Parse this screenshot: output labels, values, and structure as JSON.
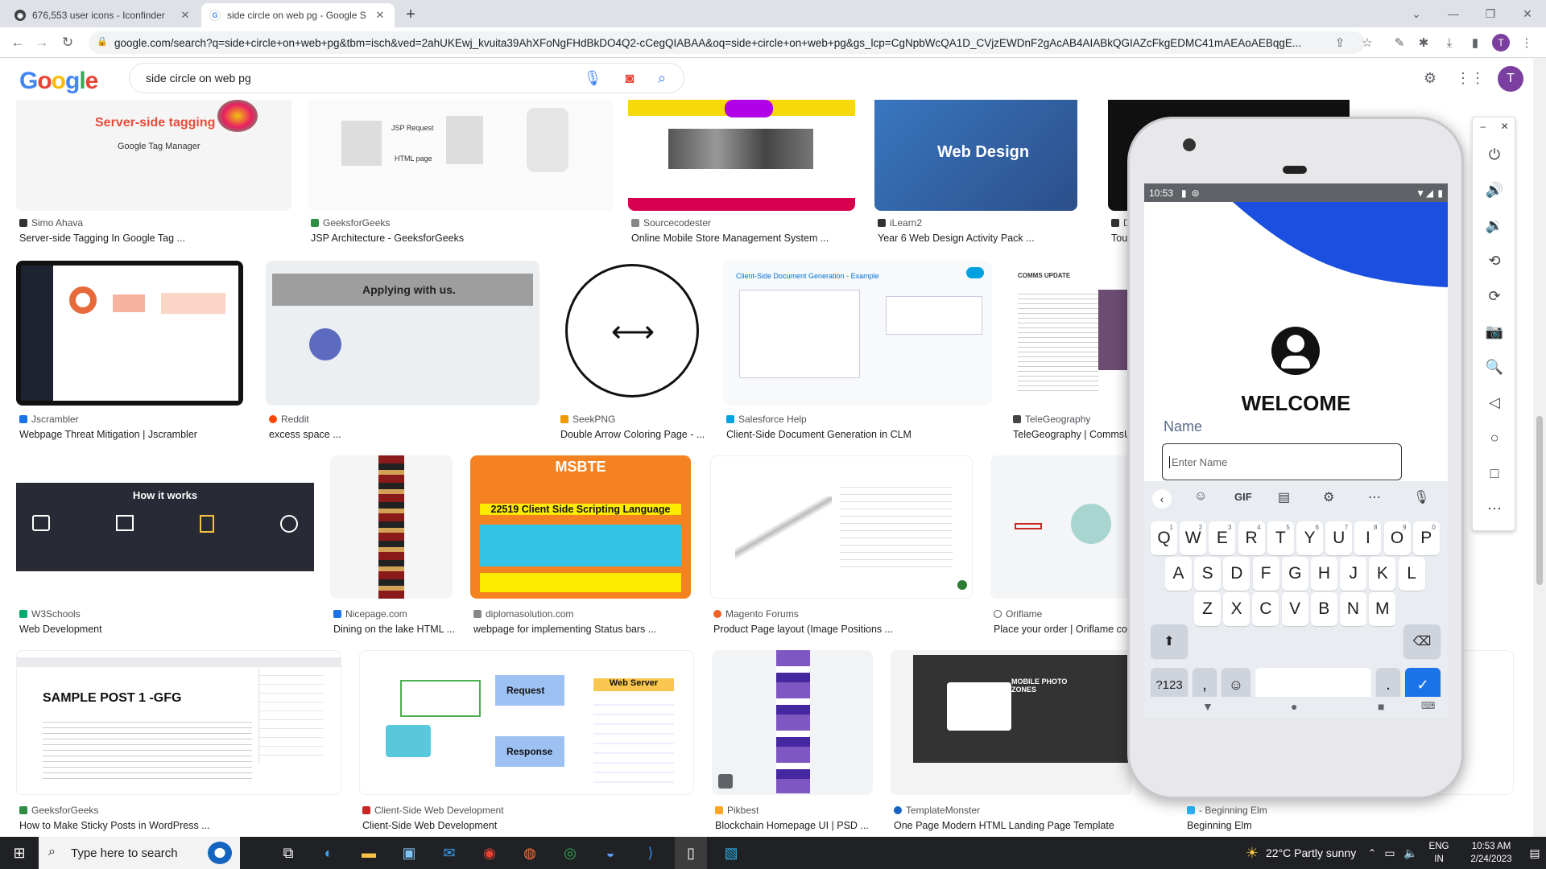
{
  "browser": {
    "tabs": [
      {
        "title": "676,553 user icons - Iconfinder",
        "favicon": "iconfinder-icon"
      },
      {
        "title": "side circle on web pg - Google S",
        "favicon": "google-icon"
      }
    ],
    "new_tab_symbol": "+",
    "url": "google.com/search?q=side+circle+on+web+pg&tbm=isch&ved=2ahUKEwj_kvuita39AhXFoNgFHdBkDO4Q2-cCegQIABAA&oq=side+circle+on+web+pg&gs_lcp=CgNpbWcQA1D_CVjzEWDnF2gAcAB4AIABkQGIAZcFkgEDMC41mAEAoAEBqgE...",
    "profile_initial": "T"
  },
  "google": {
    "logo": "Google",
    "query": "side circle on web pg",
    "profile_initial": "T"
  },
  "results": [
    {
      "source": "Simo Ahava",
      "title": "Server-side Tagging In Google Tag ...",
      "thumb_text": "Server-side tagging",
      "thumb_sub": "Google Tag Manager"
    },
    {
      "source": "GeeksforGeeks",
      "title": "JSP Architecture - GeeksforGeeks",
      "thumb_text": "JSP Request",
      "thumb_sub": "HTML page"
    },
    {
      "source": "Sourcecodester",
      "title": "Online Mobile Store Management System ..."
    },
    {
      "source": "iLearn2",
      "title": "Year 6 Web Design Activity Pack ...",
      "thumb_text": "Web Design"
    },
    {
      "source": "Jscrambler",
      "title": "Webpage Threat Mitigation | Jscrambler"
    },
    {
      "source": "Reddit",
      "title": "excess space ...",
      "thumb_text": "Applying with us."
    },
    {
      "source": "SeekPNG",
      "title": "Double Arrow Coloring Page - ..."
    },
    {
      "source": "Salesforce Help",
      "title": "Client-Side Document Generation in CLM",
      "thumb_text": "Client-Side Document Generation - Example"
    },
    {
      "source": "TeleGeography",
      "title": "TeleGeography | CommsU",
      "thumb_text": "COMMS UPDATE"
    },
    {
      "source": "W3Schools",
      "title": "Web Development",
      "thumb_text": "How it works"
    },
    {
      "source": "Nicepage.com",
      "title": "Dining on the lake HTML ..."
    },
    {
      "source": "diplomasolution.com",
      "title": "webpage for implementing Status bars ...",
      "thumb_text": "MSBTE",
      "thumb_sub": "22519 Client Side Scripting Language"
    },
    {
      "source": "Magento Forums",
      "title": "Product Page layout (Image Positions ..."
    },
    {
      "source": "Oriflame",
      "title": "Place your order | Oriflame cos"
    },
    {
      "source": "GeeksforGeeks",
      "title": "How to Make Sticky Posts in WordPress ...",
      "thumb_text": "SAMPLE POST 1 -GFG"
    },
    {
      "source": "Client-Side Web Development",
      "title": "Client-Side Web Development",
      "thumb_text": "Request",
      "thumb_sub": "Response",
      "thumb_extra": "Web Server"
    },
    {
      "source": "Pikbest",
      "title": "Blockchain Homepage UI | PSD ..."
    },
    {
      "source": "TemplateMonster",
      "title": "One Page Modern HTML Landing Page Template",
      "thumb_text": "MOBILE PHOTO ZONES"
    },
    {
      "source": "- Beginning Elm",
      "title": "Beginning Elm"
    },
    {
      "source": "D",
      "title": "Touc"
    }
  ],
  "emulator": {
    "time": "10:53",
    "welcome": "WELCOME",
    "name_label": "Name",
    "name_placeholder": "Enter Name",
    "keyboard": {
      "row1": [
        "Q",
        "W",
        "E",
        "R",
        "T",
        "Y",
        "U",
        "I",
        "O",
        "P"
      ],
      "row1_nums": [
        "1",
        "2",
        "3",
        "4",
        "5",
        "6",
        "7",
        "8",
        "9",
        "0"
      ],
      "row2": [
        "A",
        "S",
        "D",
        "F",
        "G",
        "H",
        "J",
        "K",
        "L"
      ],
      "row3": [
        "Z",
        "X",
        "C",
        "V",
        "B",
        "N",
        "M"
      ],
      "symbols_key": "?123",
      "comma": ",",
      "period": ".",
      "gif": "GIF"
    }
  },
  "taskbar": {
    "search_placeholder": "Type here to search",
    "weather": "22°C  Partly sunny",
    "language": "ENG",
    "region": "IN",
    "time": "10:53 AM",
    "date": "2/24/2023"
  },
  "colors": {
    "accent": "#1a73e8",
    "emulator_wave": "#1a4fe0"
  }
}
